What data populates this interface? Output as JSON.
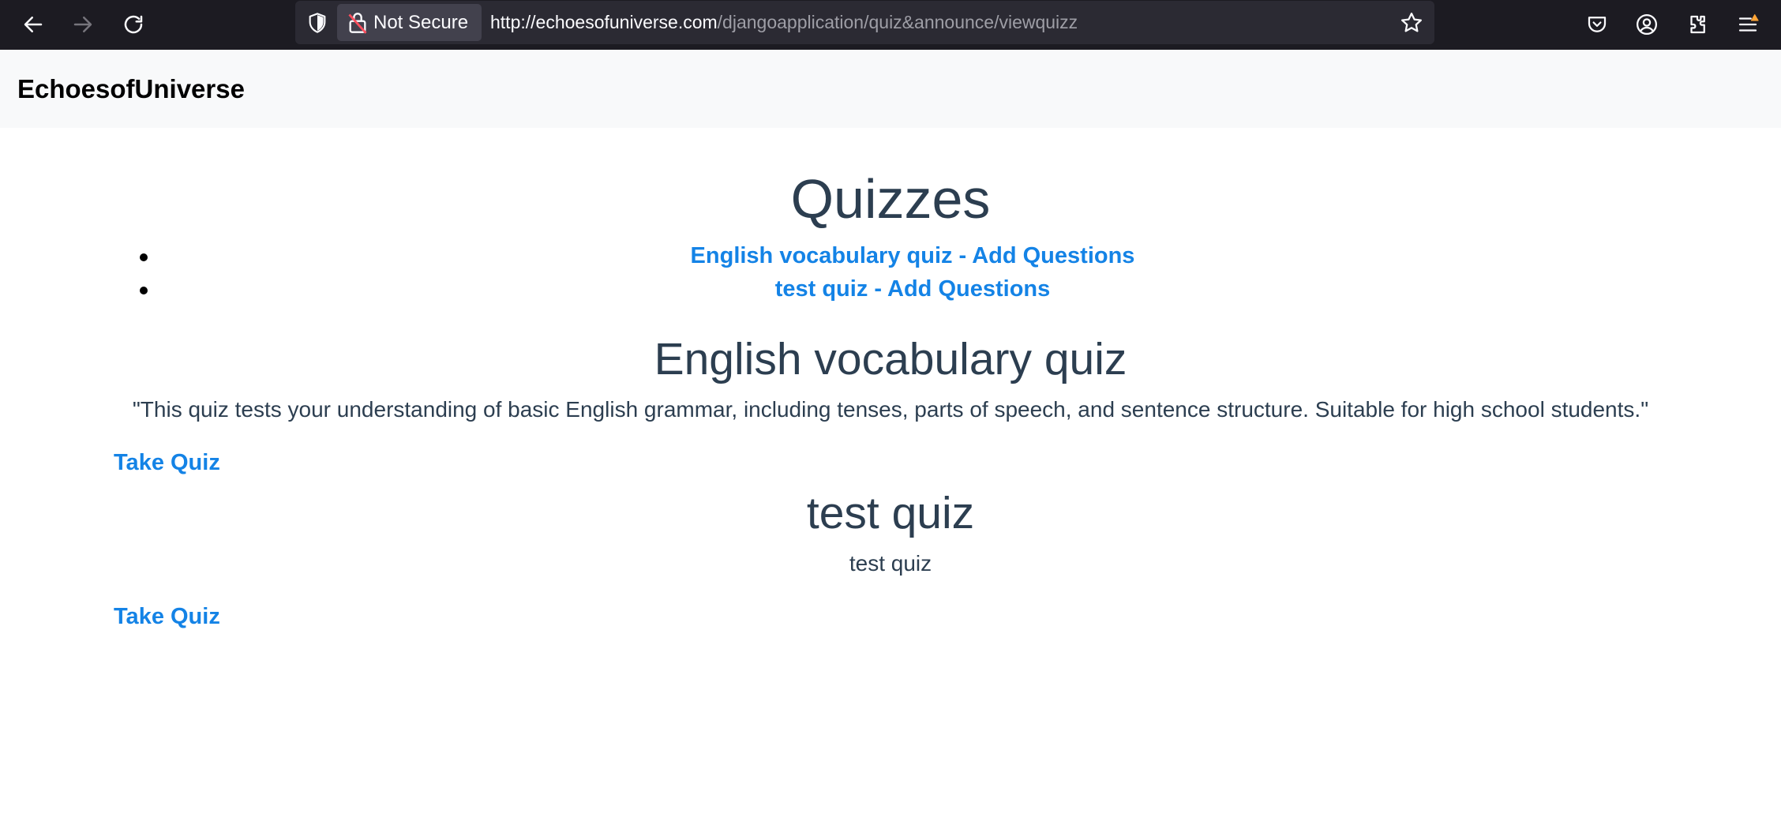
{
  "browser": {
    "security_label": "Not Secure",
    "url_host": "http://echoesofuniverse.com",
    "url_path": "/djangoapplication/quiz&announce/viewquizz",
    "icons": [
      "back-icon",
      "forward-icon",
      "reload-icon",
      "shield-icon",
      "insecure-lock-icon",
      "bookmark-star-icon",
      "pocket-icon",
      "account-icon",
      "extensions-icon",
      "menu-icon"
    ]
  },
  "site": {
    "brand": "EchoesofUniverse"
  },
  "page": {
    "title": "Quizzes",
    "quiz_links": [
      {
        "label": "English vocabulary quiz - Add Questions"
      },
      {
        "label": "test quiz - Add Questions"
      }
    ],
    "quizzes": [
      {
        "title": "English vocabulary quiz",
        "description": "\"This quiz tests your understanding of basic English grammar, including tenses, parts of speech, and sentence structure. Suitable for high school students.\"",
        "action": "Take Quiz"
      },
      {
        "title": "test quiz",
        "description": "test quiz",
        "action": "Take Quiz"
      }
    ]
  },
  "colors": {
    "link": "#1483e6",
    "text": "#2c3e50",
    "toolbar": "#1c1b22",
    "navbar": "#f8f9fa"
  }
}
